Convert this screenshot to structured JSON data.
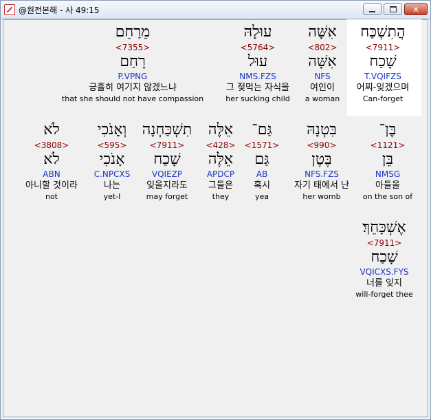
{
  "window": {
    "title": "@원전본해 - 사 49:15",
    "buttons": {
      "minimize": "",
      "maximize": "",
      "close": "✕"
    }
  },
  "rows": [
    [
      {
        "hebrew": "הֲתִשְׁכַּח",
        "strong": "<7911>",
        "lemma": "שָׁכַח",
        "morph": "T.VQIFZS",
        "korean": "어찌-잊겠으며",
        "english": "Can-forget"
      },
      {
        "hebrew": "אִשָּׁה",
        "strong": "<802>",
        "lemma": "אִשָּׁה",
        "morph": "NFS",
        "korean": "여인이",
        "english": "a woman"
      },
      {
        "hebrew": "עוּלָהּ",
        "strong": "<5764>",
        "lemma": "עוּל",
        "morph": "NMS.FZS",
        "korean": "그 젖먹는 자식을",
        "english": "her sucking child"
      },
      {
        "hebrew": "מֵרַחֵם",
        "strong": "<7355>",
        "lemma": "רָחַם",
        "morph": "P.VPNG",
        "korean": "긍휼히 여기지 않겠느냐",
        "english": "that she should not have compassion"
      }
    ],
    [
      {
        "hebrew": "בֶּן־",
        "strong": "<1121>",
        "lemma": "בֵּן",
        "morph": "NMSG",
        "korean": "아들을",
        "english": "on the son of"
      },
      {
        "hebrew": "בִּטְנָהּ",
        "strong": "<990>",
        "lemma": "בֶּטֶן",
        "morph": "NFS.FZS",
        "korean": "자기 태에서 난",
        "english": "her womb"
      },
      {
        "hebrew": "גַּם־",
        "strong": "<1571>",
        "lemma": "גַּם",
        "morph": "AB",
        "korean": "혹시",
        "english": "yea"
      },
      {
        "hebrew": "אֵלֶּה",
        "strong": "<428>",
        "lemma": "אֵלֶּה",
        "morph": "APDCP",
        "korean": "그들은",
        "english": "they"
      },
      {
        "hebrew": "תִשְׁכַּחְנָה",
        "strong": "<7911>",
        "lemma": "שָׁכַח",
        "morph": "VQIEZP",
        "korean": "잊을지라도",
        "english": "may forget"
      },
      {
        "hebrew": "וְאָנֹכִי",
        "strong": "<595>",
        "lemma": "אָנֹכִי",
        "morph": "C.NPCXS",
        "korean": "나는",
        "english": "yet-I"
      },
      {
        "hebrew": "לֹא",
        "strong": "<3808>",
        "lemma": "לֹא",
        "morph": "ABN",
        "korean": "아니할 것이라",
        "english": "not"
      }
    ],
    [
      {
        "hebrew": "אֶשְׁכָּחֵךְ׃",
        "strong": "<7911>",
        "lemma": "שָׁכַח",
        "morph": "VQICXS.FYS",
        "korean": "너를 잊지",
        "english": "will-forget thee"
      }
    ]
  ]
}
